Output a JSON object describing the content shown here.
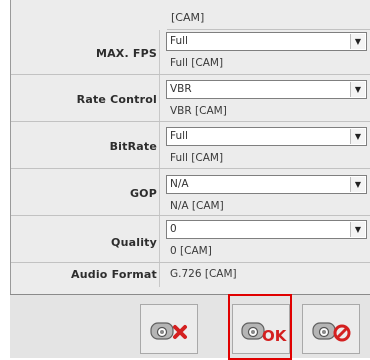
{
  "top": {
    "cam_value": "[CAM]"
  },
  "rows": [
    {
      "label": "MAX. FPS",
      "selected": "Full",
      "cam": "Full [CAM]"
    },
    {
      "label": "Rate Control",
      "selected": "VBR",
      "cam": "VBR [CAM]"
    },
    {
      "label": "BitRate",
      "selected": "Full",
      "cam": "Full [CAM]"
    },
    {
      "label": "GOP",
      "selected": "N/A",
      "cam": "N/A [CAM]"
    },
    {
      "label": "Quality",
      "selected": "0",
      "cam": "0 [CAM]"
    }
  ],
  "audio": {
    "label": "Audio Format",
    "value": "G.726 [CAM]"
  },
  "buttons": {
    "cancel": {
      "icon": "camera-delete-icon"
    },
    "ok": {
      "icon": "camera-ok-icon",
      "text": "OK"
    },
    "stop": {
      "icon": "camera-stop-icon"
    }
  },
  "colors": {
    "highlight": "#e00000",
    "icon_red": "#d42020"
  }
}
